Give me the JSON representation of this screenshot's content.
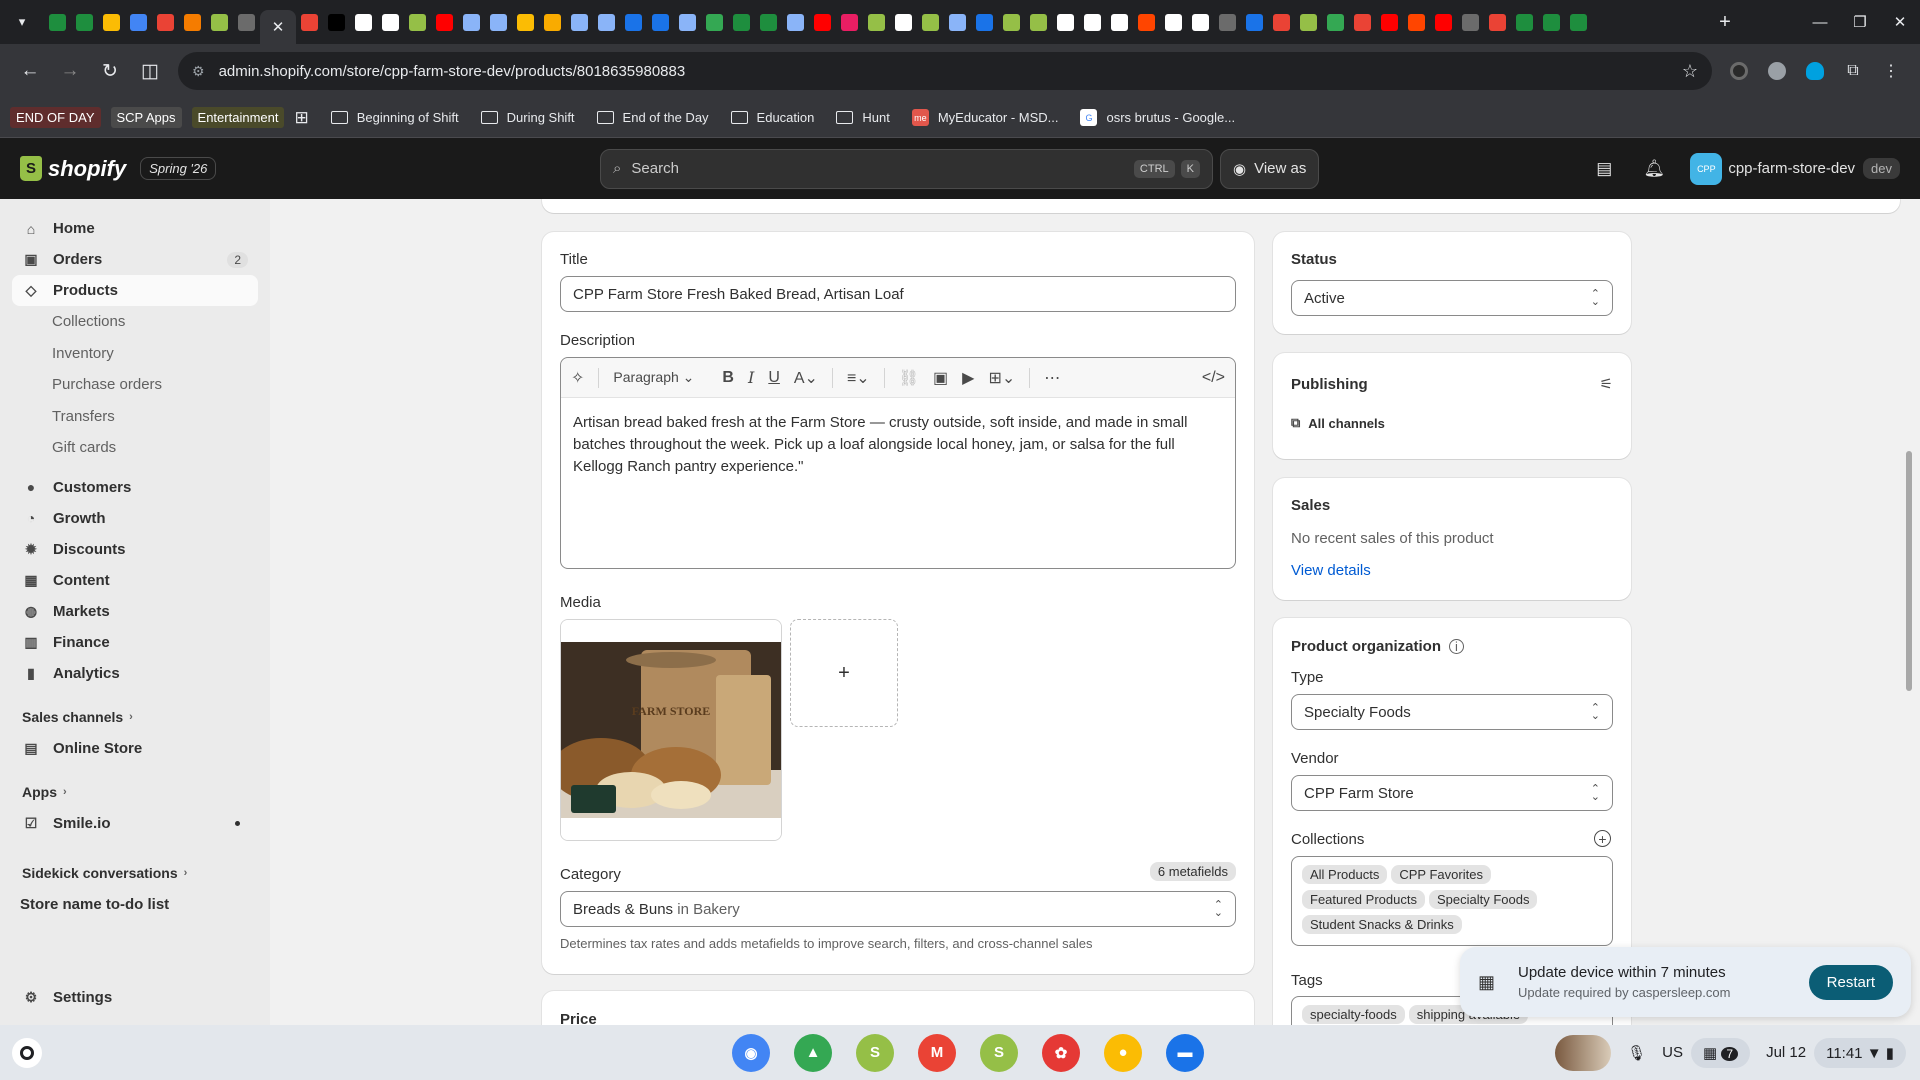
{
  "browser": {
    "url": "admin.shopify.com/store/cpp-farm-store-dev/products/8018635980883",
    "tab_colors": [
      "#1e8e3e",
      "#1e8e3e",
      "#fbbc04",
      "#4285f4",
      "#ea4335",
      "#f57c00",
      "#95bf47",
      "#6b6b6b",
      "#ea4335",
      "#000000",
      "#ffffff",
      "#ffffff",
      "#95bf47",
      "#ff0000",
      "#8ab4f8",
      "#8ab4f8",
      "#fbbc04",
      "#f9ab00",
      "#8ab4f8",
      "#8ab4f8",
      "#1a73e8",
      "#1a73e8",
      "#8ab4f8",
      "#34a853",
      "#1e8e3e",
      "#1e8e3e",
      "#8ab4f8",
      "#ff0000",
      "#e91e63",
      "#95bf47",
      "#ffffff",
      "#95bf47",
      "#8ab4f8",
      "#1a73e8",
      "#95bf47",
      "#95bf47",
      "#ffffff",
      "#ffffff",
      "#ffffff",
      "#ff4500",
      "#ffffff",
      "#ffffff",
      "#6b6b6b",
      "#1a73e8",
      "#ea4335",
      "#95bf47",
      "#34a853",
      "#ea4335",
      "#ff0000",
      "#ff4500",
      "#ff0000",
      "#6b6b6b",
      "#ea4335",
      "#1e8e3e",
      "#1e8e3e",
      "#1e8e3e"
    ],
    "bookmarks": {
      "chips": [
        {
          "label": "END OF DAY",
          "color": "#5f2d2d"
        },
        {
          "label": "SCP Apps",
          "color": "#4a4a4a"
        },
        {
          "label": "Entertainment",
          "color": "#4a4a2a"
        }
      ],
      "folders": [
        "Beginning of Shift",
        "During Shift",
        "End of the Day",
        "Education",
        "Hunt"
      ],
      "links": [
        {
          "label": "MyEducator - MSD...",
          "icon_text": "me",
          "color": "#e2574c"
        },
        {
          "label": "osrs brutus - Google...",
          "icon_text": "G",
          "color": "#ffffff"
        }
      ]
    }
  },
  "shopify": {
    "edition": "Spring '26",
    "logo_text": "shopify",
    "search_placeholder": "Search",
    "shortcut_ctrl": "CTRL",
    "shortcut_key": "K",
    "view_as": "View as",
    "store_avatar": "CPP",
    "store_name": "cpp-farm-store-dev",
    "store_badge": "dev"
  },
  "sidebar": {
    "home": "Home",
    "orders": "Orders",
    "orders_count": "2",
    "products": "Products",
    "product_sub": [
      "Collections",
      "Inventory",
      "Purchase orders",
      "Transfers",
      "Gift cards"
    ],
    "customers": "Customers",
    "growth": "Growth",
    "discounts": "Discounts",
    "content": "Content",
    "markets": "Markets",
    "finance": "Finance",
    "analytics": "Analytics",
    "sales_channels": "Sales channels",
    "online_store": "Online Store",
    "apps": "Apps",
    "smile": "Smile.io",
    "sidekick": "Sidekick conversations",
    "todo": "Store name to-do list",
    "settings": "Settings"
  },
  "product": {
    "title_label": "Title",
    "title_value": "CPP Farm Store Fresh Baked Bread, Artisan Loaf",
    "description_label": "Description",
    "paragraph_label": "Paragraph",
    "description": "Artisan bread baked fresh at the Farm Store — crusty outside, soft inside, and made in small batches throughout the week. Pick up a loaf alongside local honey, jam, or salsa for the full Kellogg Ranch pantry experience.\"",
    "media_label": "Media",
    "media_image_text": "FARM STORE",
    "category_label": "Category",
    "metafields": "6 metafields",
    "category_value": "Breads & Buns",
    "category_in": "in Bakery",
    "category_help": "Determines tax rates and adds metafields to improve search, filters, and cross-channel sales",
    "price_label": "Price"
  },
  "side_cards": {
    "status_label": "Status",
    "status_value": "Active",
    "publishing_label": "Publishing",
    "publishing_channels": "All channels",
    "sales_label": "Sales",
    "sales_text": "No recent sales of this product",
    "sales_link": "View details",
    "org_label": "Product organization",
    "type_label": "Type",
    "type_value": "Specialty Foods",
    "vendor_label": "Vendor",
    "vendor_value": "CPP Farm Store",
    "collections_label": "Collections",
    "collections": [
      "All Products",
      "CPP Favorites",
      "Featured Products",
      "Specialty Foods",
      "Student Snacks & Drinks"
    ],
    "tags_label": "Tags",
    "tags": [
      "specialty-foods",
      "shipping available"
    ]
  },
  "toast": {
    "title": "Update device within 7 minutes",
    "subtitle": "Update required by caspersleep.com",
    "button": "Restart"
  },
  "shelf": {
    "apps": [
      {
        "name": "chrome-app",
        "color": "#4285f4",
        "glyph": "◉"
      },
      {
        "name": "drive-app",
        "color": "#34a853",
        "glyph": "▲"
      },
      {
        "name": "slides-app",
        "color": "#95bf47",
        "glyph": "S"
      },
      {
        "name": "gmail-app",
        "color": "#ea4335",
        "glyph": "M"
      },
      {
        "name": "shopify-app",
        "color": "#95bf47",
        "glyph": "S"
      },
      {
        "name": "paint-app",
        "color": "#e53935",
        "glyph": "✿"
      },
      {
        "name": "keep-app",
        "color": "#fbbc04",
        "glyph": "●"
      },
      {
        "name": "files-app",
        "color": "#1a73e8",
        "glyph": "▬"
      }
    ],
    "locale": "US",
    "notification_count": "7",
    "date": "Jul 12",
    "time": "11:41"
  }
}
